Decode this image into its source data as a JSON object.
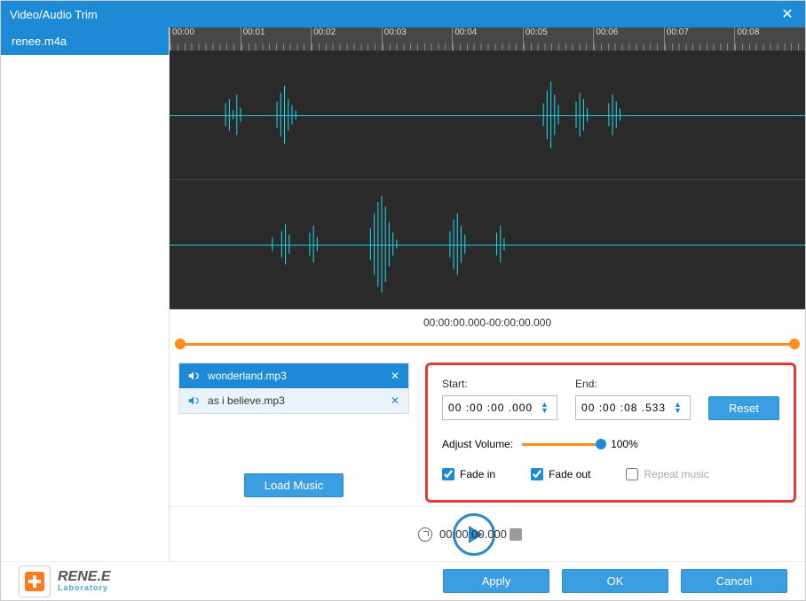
{
  "titlebar": {
    "title": "Video/Audio Trim"
  },
  "sidebar": {
    "items": [
      {
        "label": "renee.m4a"
      }
    ]
  },
  "ruler": {
    "ticks": [
      "00:00",
      "00:01",
      "00:02",
      "00:03",
      "00:04",
      "00:05",
      "00:06",
      "00:07",
      "00:08"
    ]
  },
  "range": {
    "label": "00:00:00.000-00:00:00.000"
  },
  "music": {
    "items": [
      {
        "name": "wonderland.mp3",
        "active": true
      },
      {
        "name": "as i believe.mp3",
        "active": false
      }
    ],
    "load_label": "Load Music"
  },
  "settings": {
    "start_label": "Start:",
    "end_label": "End:",
    "start_value": "00 :00 :00 .000",
    "end_value": "00 :00 :08 .533",
    "reset_label": "Reset",
    "volume_label": "Adjust Volume:",
    "volume_value": "100%",
    "fade_in_label": "Fade in",
    "fade_out_label": "Fade out",
    "repeat_label": "Repeat music",
    "fade_in_checked": true,
    "fade_out_checked": true,
    "repeat_checked": false
  },
  "transport": {
    "time": "00:00:00.000"
  },
  "footer": {
    "brand": "RENE.E",
    "brand_sub": "Laboratory",
    "apply": "Apply",
    "ok": "OK",
    "cancel": "Cancel"
  }
}
